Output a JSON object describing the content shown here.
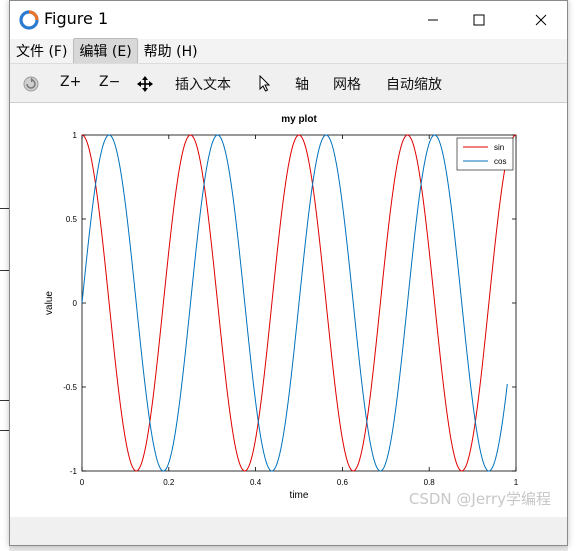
{
  "window": {
    "title": "Figure 1"
  },
  "menu": {
    "items": [
      "文件 (F)",
      "编辑 (E)",
      "帮助 (H)"
    ],
    "active_index": 1
  },
  "toolbar": {
    "zoom_in": "Z+",
    "zoom_out": "Z−",
    "insert_text": "插入文本",
    "axes": "轴",
    "grid": "网格",
    "autoscale": "自动缩放"
  },
  "watermark": "CSDN @Jerry学编程",
  "colors": {
    "sin": "#e00000",
    "cos": "#0072bd"
  },
  "chart_data": {
    "type": "line",
    "title": "my plot",
    "xlabel": "time",
    "ylabel": "value",
    "xlim": [
      0,
      1
    ],
    "ylim": [
      -1,
      1
    ],
    "xticks": [
      "0",
      "0.2",
      "0.4",
      "0.6",
      "0.8",
      "1"
    ],
    "yticks": [
      "1",
      "0.5",
      "0",
      "-0.5",
      "-1"
    ],
    "legend_position": "top-right",
    "series": [
      {
        "name": "sin",
        "function": "cos(2*pi*4*t)",
        "color": "#e00000",
        "x_range": [
          0,
          1
        ]
      },
      {
        "name": "cos",
        "function": "sin(2*pi*4*t)",
        "color": "#0072bd",
        "x_range": [
          0,
          0.98
        ]
      }
    ]
  }
}
